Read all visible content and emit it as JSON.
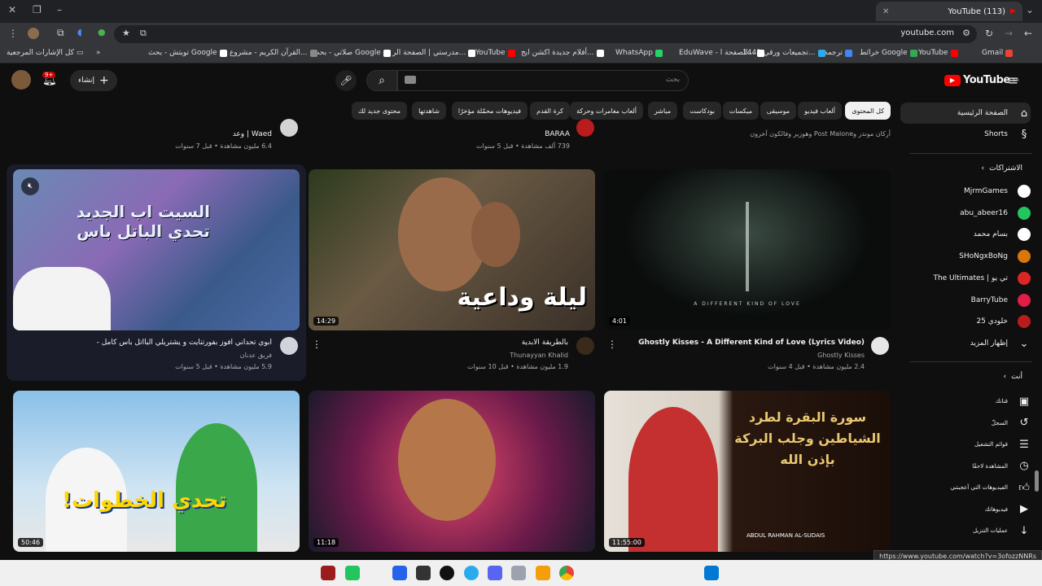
{
  "browser": {
    "tab_title": "(113) YouTube",
    "url": "youtube.com",
    "status_url": "https://www.youtube.com/watch?v=3ofozzNNRs"
  },
  "bookmarks": [
    {
      "label": "Gmail",
      "color": "#ea4335"
    },
    {
      "label": "YouTube",
      "color": "#ff0000"
    },
    {
      "label": "خرائط Google",
      "color": "#34a853"
    },
    {
      "label": "ترجمة",
      "color": "#4285f4"
    },
    {
      "label": "تجميعات ورقي 1443...",
      "color": "#2aabee"
    },
    {
      "label": "EduWave - الصفحة ا...",
      "color": "#ffffff"
    },
    {
      "label": "WhatsApp",
      "color": "#25d366"
    },
    {
      "label": "أفلام جديدة اكشن ايج...",
      "color": "#ffffff"
    },
    {
      "label": "YouTube",
      "color": "#ff0000"
    },
    {
      "label": "مدرستي | الصفحة الر...",
      "color": "#ffffff"
    },
    {
      "label": "صلاتي - بحث Google",
      "color": "#ffffff"
    },
    {
      "label": "القرآن الكريم - مشروع...",
      "color": "#888888"
    },
    {
      "label": "تويتش - بحث Google",
      "color": "#ffffff"
    }
  ],
  "bookmarks_all": "كل الإشارات المرجعية",
  "youtube": {
    "logo": "YouTube",
    "logo_region": "SA",
    "search_placeholder": "بحث",
    "create_label": "إنشاء",
    "notif_count": "9+"
  },
  "chips": [
    "كل المحتوى",
    "ألعاب فيديو",
    "موسيقى",
    "ميكسات",
    "بودكاست",
    "مباشر",
    "ألعاب مغامرات وحركة",
    "كرة القدم",
    "فيديوهات محمّلة مؤخرًا",
    "شاهدتها",
    "محتوى جديد لك"
  ],
  "sidebar": {
    "home": "الصفحة الرئيسية",
    "shorts": "Shorts",
    "subs_header": "الاشتراكات",
    "subs": [
      {
        "name": "MjrmGames",
        "color": "#ffffff"
      },
      {
        "name": "abu_abeer16",
        "color": "#22c55e"
      },
      {
        "name": "بسام محمد",
        "color": "#ffffff"
      },
      {
        "name": "SHoNgxBoNg",
        "color": "#d97706"
      },
      {
        "name": "The Ultimates | تي يو",
        "color": "#dc2626"
      },
      {
        "name": "BarryTube",
        "color": "#e11d48"
      },
      {
        "name": "خلودي 25",
        "color": "#b91c1c"
      }
    ],
    "show_more": "إظهار المزيد",
    "you_header": "أنت",
    "you_items": [
      "قناتك",
      "السجلّ",
      "قوائم التشغيل",
      "المشاهدة لاحقًا",
      "الفيديوهات التي أعجبتني",
      "فيديوهاتك",
      "عمليات التنزيل"
    ]
  },
  "top_row": [
    {
      "channel": "Post Malone وهوزير وفالكون آخرون",
      "meta": "أركان موندز و"
    },
    {
      "channel": "BARAA",
      "meta": "739 ألف مشاهدة • قبل 5 سنوات"
    },
    {
      "channel": "Waed | وعد",
      "meta": "6.4 مليون مشاهدة • قبل 7 سنوات"
    }
  ],
  "videos": [
    {
      "title": "Ghostly Kisses - A Different Kind of Love (Lyrics Video)",
      "channel": "Ghostly Kisses",
      "meta": "2.4 مليون مشاهدة • قبل 4 سنوات",
      "duration": "4:01",
      "overlay": "A DIFFERENT KIND OF LOVE"
    },
    {
      "title": "بالطريقة الابدية",
      "channel": "Thunayyan Khalid",
      "meta": "1.9 مليون مشاهدة • قبل 10 سنوات",
      "duration": "14:29",
      "overlay": "ليلة وداعية"
    },
    {
      "title": "أبوي تحداني أفوز بفورتنايت و يشتريلي البااتل باس كامل -",
      "channel": "فريق عدنان",
      "meta": "5.9 مليون مشاهدة • قبل 5 سنوات",
      "duration": "",
      "overlay": "السيت اب الجديد تحدي الباتل باس"
    },
    {
      "title": "",
      "channel": "",
      "meta": "",
      "duration": "11:55:00",
      "overlay": "سورة البقرة لطرد الشياطين وجلب البركة بإذن الله",
      "overlay2": "ABDUL RAHMAN AL-SUDAIS"
    },
    {
      "title": "",
      "channel": "",
      "meta": "",
      "duration": "11:18",
      "overlay": ""
    },
    {
      "title": "",
      "channel": "",
      "meta": "",
      "duration": "50:46",
      "overlay": "تحدي الخطوات!"
    }
  ]
}
